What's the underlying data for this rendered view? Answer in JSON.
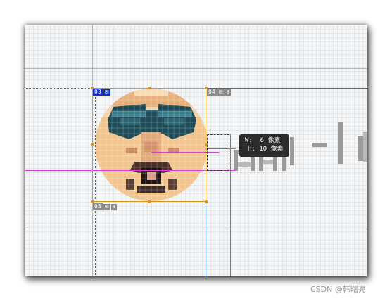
{
  "tags": {
    "top_left": {
      "number": "03",
      "icon": "image-icon"
    },
    "top_right": {
      "number": "04",
      "icon": "image-icon",
      "extra": "lock-icon"
    },
    "bottom_left": {
      "number": "05",
      "icon": "image-icon",
      "extra": "lock-icon"
    }
  },
  "tooltip": {
    "width_line": "W:  6 像素",
    "height_line": "H: 10 像素"
  },
  "watermark": "CSDN @韩曙亮",
  "colors": {
    "guide_cyan": "#5fd6e6",
    "guide_blue": "#2a6cd8",
    "measure_magenta": "#d43fd4",
    "selection_orange": "#d49624",
    "tag_blue": "#1230c8",
    "tag_gray": "#8c8c8c",
    "tooltip_bg": "#2b2b2b"
  }
}
